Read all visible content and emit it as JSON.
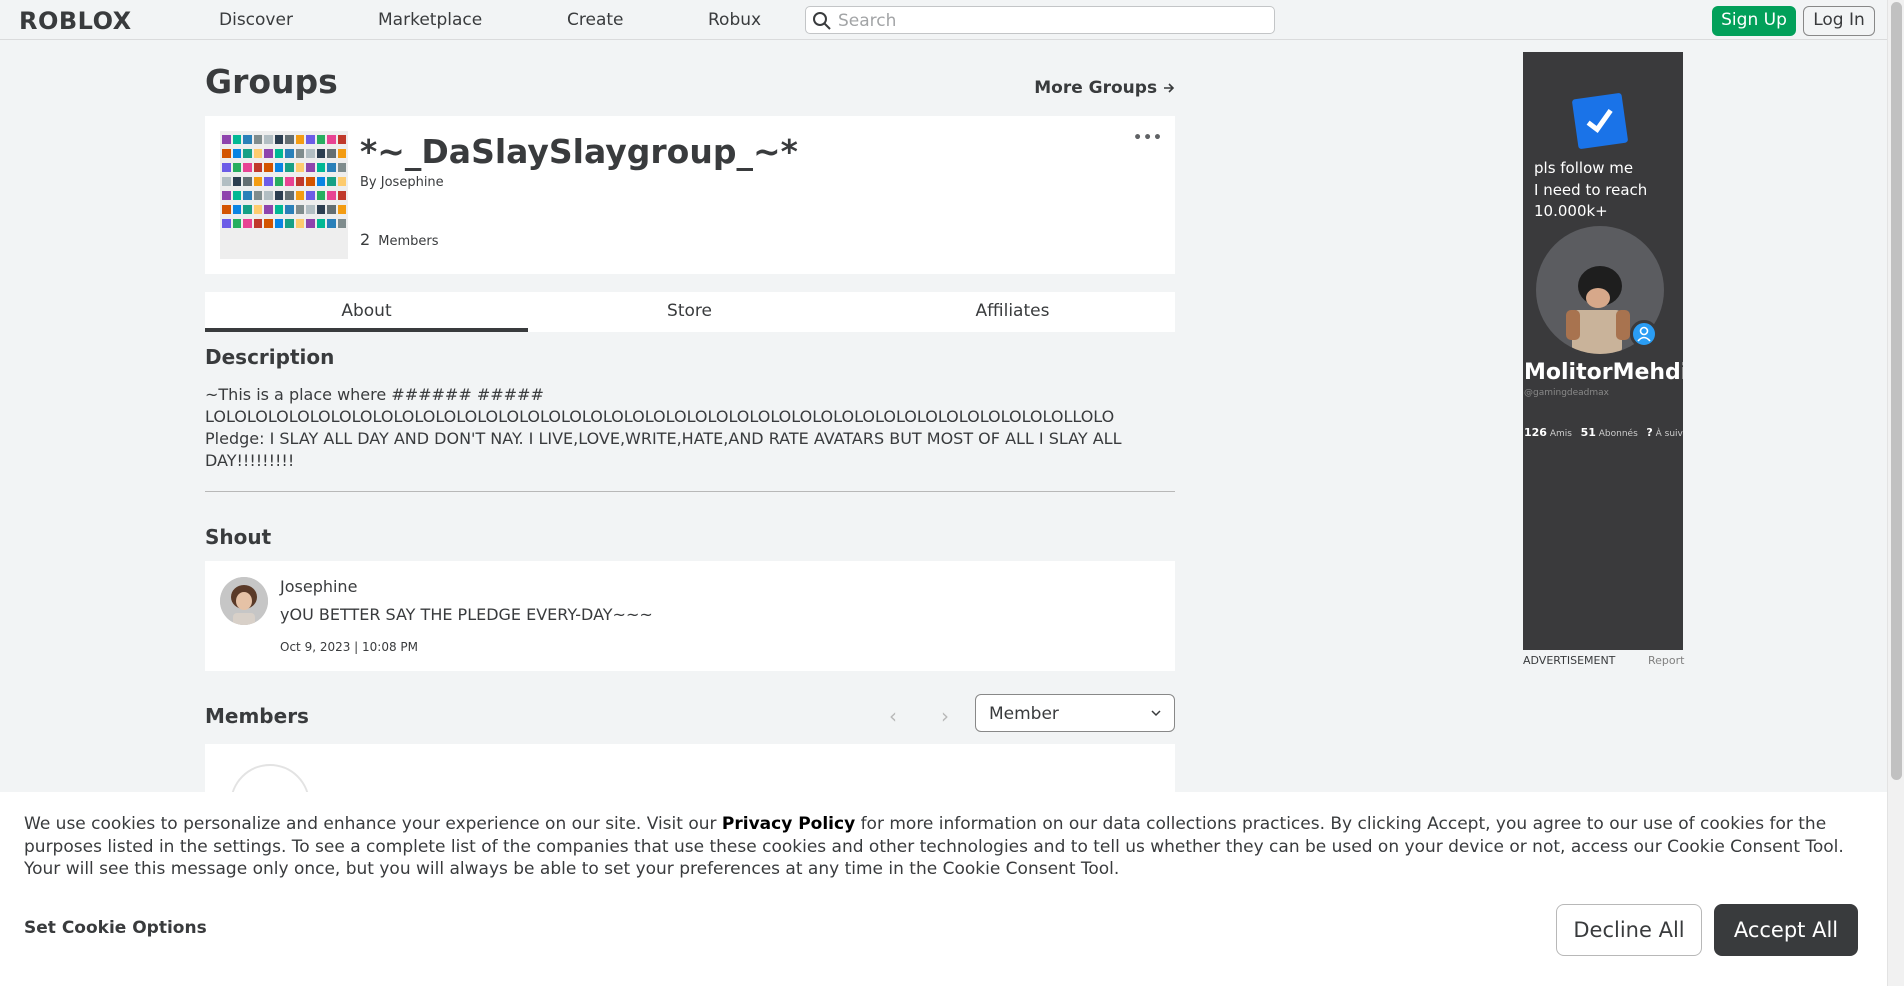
{
  "nav": {
    "logo": "ROBLOX",
    "links": [
      "Discover",
      "Marketplace",
      "Create",
      "Robux"
    ],
    "search_placeholder": "Search",
    "signup": "Sign Up",
    "login": "Log In"
  },
  "page": {
    "title": "Groups",
    "more_groups": "More Groups",
    "more_groups_icon": "arrow-right-icon"
  },
  "group": {
    "name": "*~_DaSlaySlaygroup_~*",
    "by_label": "By",
    "owner": "Josephine",
    "member_count": "2",
    "member_label": "Members",
    "menu_icon": "ellipsis-icon"
  },
  "tabs": [
    "About",
    "Store",
    "Affiliates"
  ],
  "description": {
    "title": "Description",
    "text": "~This is a place where ###### ##### LOLOLOLOLOLOLOLOLOLOLOLOLOLOLOLOLOLOLOLOLOLOLOLOLOLOLOLOLOLOLOLOLOLOLOLOLOLOLOLOLOLLOLO Pledge: I SLAY ALL DAY AND DON'T NAY. I LIVE,LOVE,WRITE,HATE,AND RATE AVATARS BUT MOST OF ALL I SLAY ALL DAY!!!!!!!!!"
  },
  "shout": {
    "title": "Shout",
    "user": "Josephine",
    "message": "yOU BETTER SAY THE PLEDGE EVERY-DAY~~~",
    "date": "Oct 9, 2023 | 10:08 PM"
  },
  "members": {
    "title": "Members",
    "role_filter": "Member"
  },
  "ad": {
    "line1": "pls follow me",
    "line2": "I need to reach",
    "line3": "10.000k+",
    "name": "MolitorMehdi",
    "handle": "@gamingdeadmax",
    "stat1_num": "126",
    "stat1_label": "Amis",
    "stat2_num": "51",
    "stat2_label": "Abonnés",
    "stat3_num": "?",
    "stat3_label": "À suivre",
    "label": "ADVERTISEMENT",
    "report": "Report"
  },
  "cookie": {
    "text_before": "We use cookies to personalize and enhance your experience on our site. Visit our ",
    "link": "Privacy Policy",
    "text_after": " for more information on our data collections practices. By clicking Accept, you agree to our use of cookies for the purposes listed in the settings. To see a complete list of the companies that use these cookies and other technologies and to tell us whether they can be used on your device or not, access our Cookie Consent Tool. Your will see this message only once, but you will always be able to set your preferences at any time in the Cookie Consent Tool.",
    "set_options": "Set Cookie Options",
    "decline": "Decline All",
    "accept": "Accept All"
  },
  "colors": {
    "signup_bg": "#02a05a",
    "accept_bg": "#393b3d",
    "ad_bg": "#3a3a3c",
    "ad_check": "#1a73e8"
  }
}
